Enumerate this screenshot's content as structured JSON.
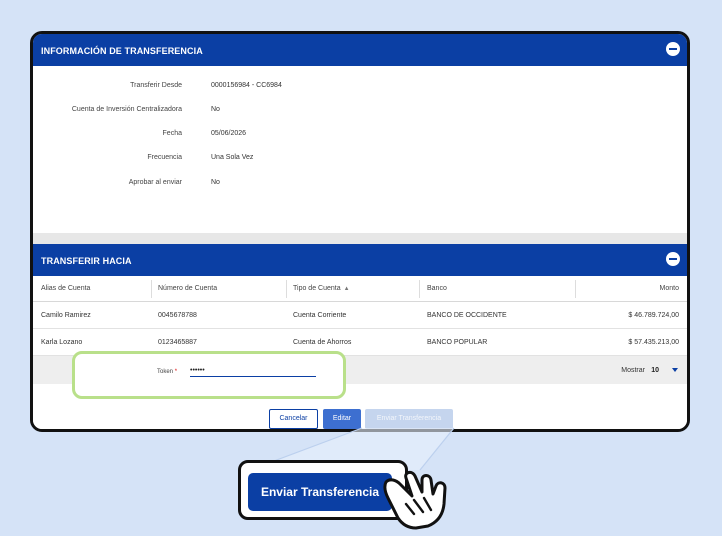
{
  "info_section": {
    "title": "INFORMACIÓN DE TRANSFERENCIA",
    "rows": [
      {
        "label": "Transferir Desde",
        "value": "0000156984 - CC6984"
      },
      {
        "label": "Cuenta de Inversión Centralizadora",
        "value": "No"
      },
      {
        "label": "Fecha",
        "value": "05/06/2026"
      },
      {
        "label": "Frecuencia",
        "value": "Una Sola Vez"
      },
      {
        "label": "Aprobar al enviar",
        "value": "No"
      }
    ]
  },
  "to_section": {
    "title": "TRANSFERIR HACIA",
    "columns": [
      "Alias de Cuenta",
      "Número de Cuenta",
      "Tipo de Cuenta",
      "Banco",
      "Monto"
    ],
    "sort_indicator": "▲",
    "rows": [
      {
        "alias": "Camilo Ramirez",
        "numero": "0045678788",
        "tipo": "Cuenta Corriente",
        "banco": "BANCO DE OCCIDENTE",
        "monto": "$ 46.789.724,00"
      },
      {
        "alias": "Karla Lozano",
        "numero": "0123465887",
        "tipo": "Cuenta de Ahorros",
        "banco": "BANCO POPULAR",
        "monto": "$ 57.435.213,00"
      }
    ],
    "pager": {
      "label": "Mostrar",
      "value": "10"
    }
  },
  "token": {
    "label": "Token",
    "required_mark": "*",
    "value": "••••••"
  },
  "buttons": {
    "cancel": "Cancelar",
    "edit": "Editar",
    "send": "Enviar Transferencia"
  },
  "zoom_callout": {
    "label": "Enviar Transferencia"
  },
  "icons": {
    "collapse": "minus-circle-icon",
    "sort": "sort-asc-icon",
    "pager_caret": "caret-down-icon",
    "cursor": "hand-pointer-icon"
  },
  "colors": {
    "brand": "#0b3fa4",
    "highlight": "#b9e08a",
    "background": "#d5e3f7"
  }
}
